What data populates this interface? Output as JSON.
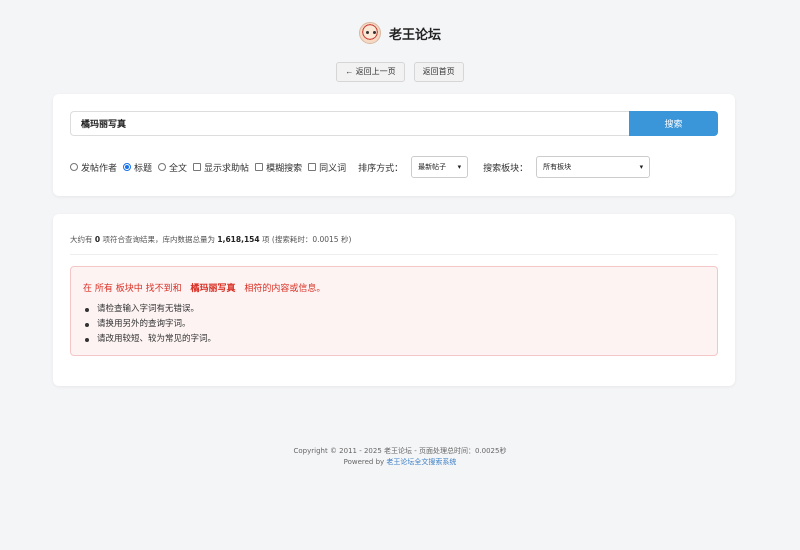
{
  "site": {
    "title": "老王论坛"
  },
  "nav": {
    "back_label": "← 返回上一页",
    "home_label": "返回首页"
  },
  "search": {
    "value": "橘玛丽写真",
    "button_label": "搜索"
  },
  "options": {
    "author_label": "发帖作者",
    "title_label": "标题",
    "fulltext_label": "全文",
    "help_label": "显示求助帖",
    "fuzzy_label": "模糊搜索",
    "synonym_label": "同义词",
    "sort_label": "排序方式：",
    "sort_value": "最新帖子",
    "board_label": "搜索板块：",
    "board_value": "所有板块"
  },
  "stats": {
    "prefix": "大约有",
    "count": "0",
    "middle": "项符合查询结果，库内数据总量为",
    "total": "1,618,154",
    "suffix": "项 (搜索耗时：0.0015 秒)"
  },
  "alert": {
    "prefix": "在 所有 板块中 找不到和",
    "keyword": "橘玛丽写真",
    "suffix": "相符的内容或信息。",
    "tips": [
      "请检查输入字词有无错误。",
      "请换用另外的查询字词。",
      "请改用较短、较为常见的字词。"
    ],
    "color": "#d93025"
  },
  "footer": {
    "copyright": "Copyright © 2011 - 2025 老王论坛 - 页面处理总时间：0.0025秒",
    "powered_prefix": "Powered by",
    "powered_link": "老王论坛全文搜索系统"
  },
  "colors": {
    "accent": "#3b95d9",
    "background": "#f4f5f7"
  }
}
